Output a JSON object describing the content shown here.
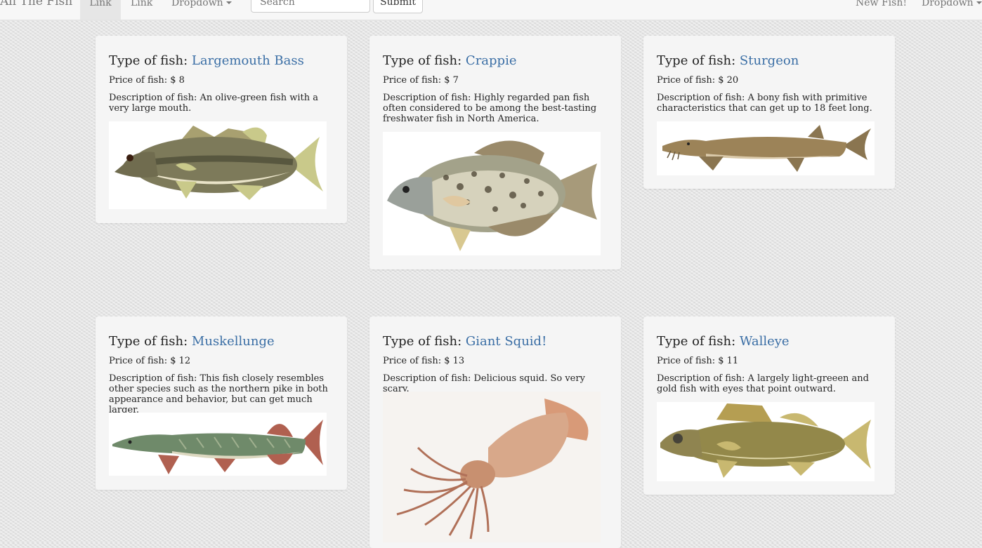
{
  "navbar": {
    "brand": "All The Fish",
    "links": [
      "Link",
      "Link"
    ],
    "dropdown": "Dropdown",
    "search_placeholder": "Search",
    "submit_label": "Submit",
    "new_fish": "New Fish!",
    "right_dropdown": "Dropdown"
  },
  "labels": {
    "type": "Type of fish: ",
    "price": "Price of fish: $ ",
    "desc": "Description of fish: "
  },
  "fish": [
    {
      "name": "Largemouth Bass",
      "price": "8",
      "description": "An olive-green fish with a very large mouth."
    },
    {
      "name": "Crappie",
      "price": "7",
      "description": "Highly regarded pan fish often considered to be among the best-tasting freshwater fish in North America."
    },
    {
      "name": "Sturgeon",
      "price": "20",
      "description": "A bony fish with primitive characteristics that can get up to 18 feet long."
    },
    {
      "name": "Muskellunge",
      "price": "12",
      "description": "This fish closely resembles other species such as the northern pike in both appearance and behavior, but can get much larger."
    },
    {
      "name": "Giant Squid!",
      "price": "13",
      "description": "Delicious squid. So very scary."
    },
    {
      "name": "Walleye",
      "price": "11",
      "description": "A largely light-greeen and gold fish with eyes that point outward."
    }
  ],
  "colors": {
    "link": "#3a6ea5",
    "card": "#f5f5f5",
    "navbar": "#f7f7f7"
  }
}
